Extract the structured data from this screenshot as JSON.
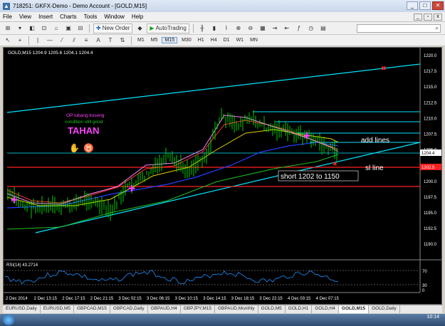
{
  "window": {
    "title": "718251: GKFX-Demo - Demo Account - [GOLD,M15]",
    "minimize": "_",
    "maximize": "□",
    "close": "✕"
  },
  "menu": {
    "items": [
      "File",
      "View",
      "Insert",
      "Charts",
      "Tools",
      "Window",
      "Help"
    ]
  },
  "toolbar": {
    "new_order": "New Order",
    "autotrading": "AutoTrading",
    "timeframes": [
      "M1",
      "M5",
      "M15",
      "M30",
      "H1",
      "H4",
      "D1",
      "W1",
      "MN"
    ],
    "active_timeframe": "M15",
    "text_tool": "A"
  },
  "chart": {
    "header": "GOLD,M15  1204.9 1205.6 1204.1 1204.4",
    "price_labels": [
      "1220.0",
      "1217.5",
      "1215.0",
      "1212.5",
      "1210.0",
      "1207.5",
      "1205.0",
      "1202.5",
      "1200.0",
      "1197.5",
      "1195.0",
      "1192.5",
      "1190.0"
    ],
    "current_price": "1204.4",
    "red_level_price": "1202.5",
    "time_labels": [
      "2 Dec 2014",
      "2 Dec 13:15",
      "2 Dec 17:15",
      "2 Dec 21:15",
      "3 Dec 02:15",
      "3 Dec 06:15",
      "3 Dec 10:15",
      "3 Dec 14:15",
      "3 Dec 18:15",
      "3 Dec 22:15",
      "4 Dec 03:15",
      "4 Dec 07:15"
    ],
    "annotations": {
      "op_text": "OP lubang koseng",
      "condition_text": "condition still good",
      "tahan_text": "TAHAN",
      "add_lines": "add lines",
      "sl_line": "sl line",
      "short_text": "short 1202 to 1150"
    },
    "rsi_label": "RSI(14) 43.2714",
    "rsi_levels": [
      "70",
      "30",
      "0"
    ],
    "colors": {
      "background": "#000000",
      "channel": "#00e5ff",
      "support": "#ff2020",
      "ma_blue": "#2040ff",
      "ma_yellow": "#e0d000",
      "ma_green": "#20c020",
      "ma_red": "#ff3030",
      "candles": "#00ff00"
    }
  },
  "tabs": [
    "EURUSD,Daily",
    "EURUSD,M5",
    "GBPCAD,M15",
    "GBPCAD,Daily",
    "GBPAUD,H4",
    "GBPJPY,M15",
    "GBPAUD,Monthly",
    "GOLD,M5",
    "GOLD,H1",
    "GOLD,H4",
    "GOLD,M15",
    "GOLD,Daily"
  ],
  "active_tab": "GOLD,M15",
  "taskbar": {
    "clock": "10:14"
  }
}
